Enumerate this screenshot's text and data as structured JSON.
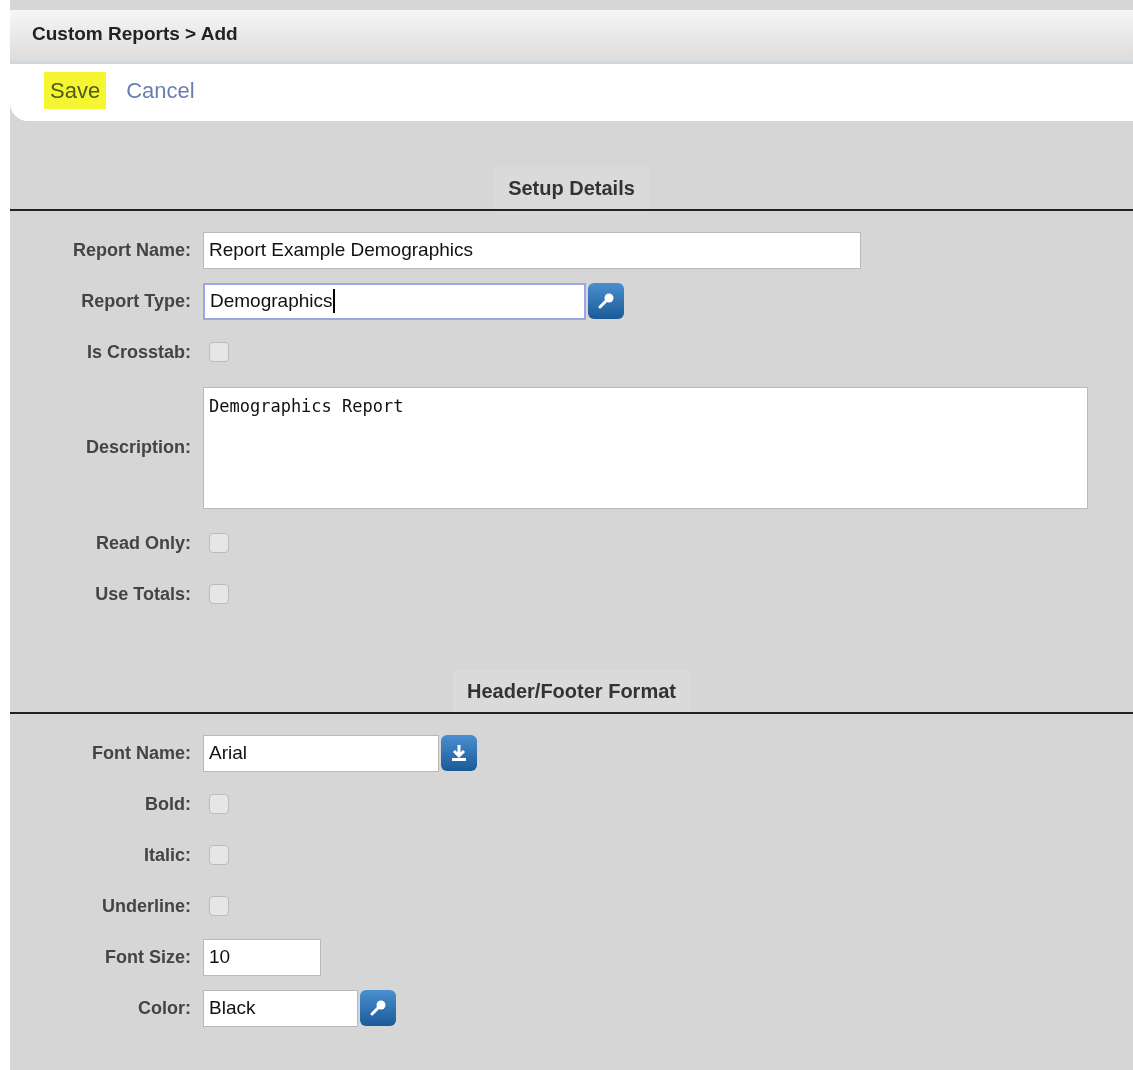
{
  "breadcrumb": "Custom Reports > Add",
  "toolbar": [
    {
      "label": "Save",
      "highlighted": true
    },
    {
      "label": "Cancel",
      "highlighted": false
    }
  ],
  "sections": [
    {
      "title": "Setup Details",
      "fields": [
        {
          "label": "Report Name:",
          "kind": "text",
          "value": "Report Example Demographics",
          "focused": false
        },
        {
          "label": "Report Type:",
          "kind": "lookup",
          "value": "Demographics",
          "focused": true
        },
        {
          "label": "Is Crosstab:",
          "kind": "checkbox",
          "checked": false
        },
        {
          "label": "Description:",
          "kind": "textarea",
          "value": "Demographics Report",
          "focused": false
        },
        {
          "label": "Read Only:",
          "kind": "checkbox",
          "checked": false
        },
        {
          "label": "Use Totals:",
          "kind": "checkbox",
          "checked": false
        }
      ]
    },
    {
      "title": "Header/Footer Format",
      "fields": [
        {
          "label": "Font Name:",
          "kind": "dropdown",
          "value": "Arial",
          "focused": false
        },
        {
          "label": "Bold:",
          "kind": "checkbox",
          "checked": false
        },
        {
          "label": "Italic:",
          "kind": "checkbox",
          "checked": false
        },
        {
          "label": "Underline:",
          "kind": "checkbox",
          "checked": false
        },
        {
          "label": "Font Size:",
          "kind": "text",
          "value": "10",
          "focused": false
        },
        {
          "label": "Color:",
          "kind": "lookup",
          "value": "Black",
          "focused": false
        }
      ]
    }
  ]
}
